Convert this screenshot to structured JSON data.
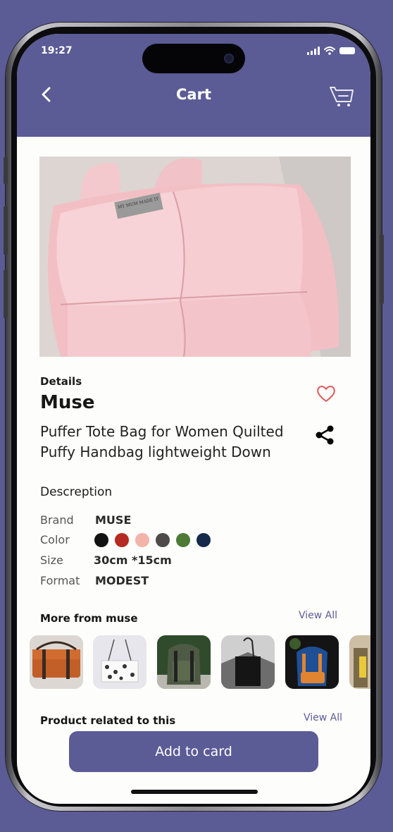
{
  "status_bar": {
    "time": "19:27"
  },
  "header": {
    "title": "Cart"
  },
  "product": {
    "details_label": "Details",
    "name": "Muse",
    "description": "Puffer Tote Bag for Women Quilted Puffy Handbag lightweight Down",
    "image_label": "MY MUM MADE IT"
  },
  "specs": {
    "heading": "Descreption",
    "brand_label": "Brand",
    "brand_value": "MUSE",
    "color_label": "Color",
    "colors": [
      "#111111",
      "#b52a23",
      "#f2b3a8",
      "#4e4a4a",
      "#4d7a34",
      "#15294a"
    ],
    "size_label": "Size",
    "size_value": "30cm *15cm",
    "format_label": "Format",
    "format_value": "MODEST"
  },
  "more_from": {
    "title": "More from muse",
    "view_all": "View All",
    "items": [
      "orange-messenger-bag",
      "patterned-tote-bag",
      "olive-backpack",
      "black-tote-bag",
      "blue-backpack",
      "partial-bag"
    ]
  },
  "related": {
    "title": "Product related to this",
    "view_all": "View All"
  },
  "add_button": {
    "label": "Add to card"
  }
}
